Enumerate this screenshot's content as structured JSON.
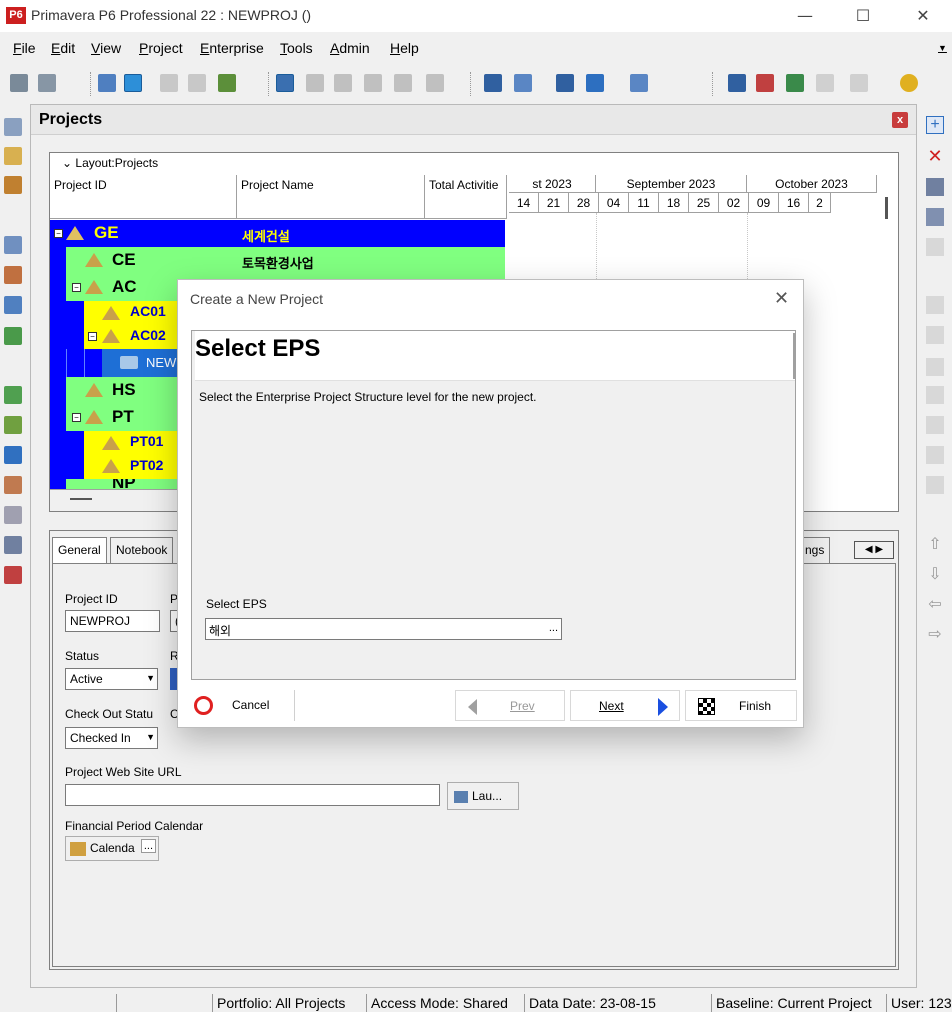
{
  "window": {
    "title": "Primavera P6 Professional 22 : NEWPROJ ()",
    "logo": "P6"
  },
  "window_controls": {
    "minimize": "—",
    "maximize": "☐",
    "close": "✕"
  },
  "menu": [
    "File",
    "Edit",
    "View",
    "Project",
    "Enterprise",
    "Tools",
    "Admin",
    "Help"
  ],
  "projects_panel": {
    "title": "Projects",
    "close": "x"
  },
  "grid": {
    "layout": "Layout:Projects",
    "columns": [
      "Project ID",
      "Project Name",
      "Total Activitie"
    ],
    "months": [
      "st 2023",
      "September 2023",
      "October 2023"
    ],
    "days": [
      "14",
      "21",
      "28",
      "04",
      "11",
      "18",
      "25",
      "02",
      "09",
      "16",
      "2"
    ],
    "rows": [
      {
        "id": "GE",
        "name": "세계건설"
      },
      {
        "id": "CE",
        "name": "토목환경사업"
      },
      {
        "id": "AC",
        "name": ""
      },
      {
        "id": "AC01",
        "name": ""
      },
      {
        "id": "AC02",
        "name": ""
      },
      {
        "id": "NEW",
        "name": ""
      },
      {
        "id": "HS",
        "name": ""
      },
      {
        "id": "PT",
        "name": ""
      },
      {
        "id": "PT01",
        "name": ""
      },
      {
        "id": "PT02",
        "name": ""
      },
      {
        "id": "NP",
        "name": ""
      }
    ]
  },
  "detail": {
    "tabs": [
      "General",
      "Notebook",
      "ngs"
    ],
    "project_id_label": "Project ID",
    "project_id_value": "NEWPROJ",
    "partial_label_a": "Pr",
    "partial_value_a": "(",
    "status_label": "Status",
    "status_value": "Active",
    "partial_label_b": "Ra",
    "checkout_label": "Check Out Statu",
    "partial_label_c": "Ch",
    "checkout_value": "Checked In",
    "web_url_label": "Project Web Site URL",
    "launch_button": "Lau...",
    "calendar_label": "Financial Period Calendar",
    "calendar_button": "Calenda",
    "ellipsis": "..."
  },
  "dialog": {
    "title": "Create a New Project",
    "heading": "Select EPS",
    "description": "Select the Enterprise Project Structure level for the new project.",
    "eps_label": "Select EPS",
    "eps_value": "해외",
    "browse": "...",
    "cancel": "Cancel",
    "prev": "Prev",
    "next": "Next",
    "finish": "Finish"
  },
  "status_bar": {
    "portfolio": "Portfolio: All Projects",
    "access_mode": "Access Mode: Shared",
    "data_date": "Data Date: 23-08-15",
    "baseline": "Baseline: Current Project",
    "user": "User: 123"
  },
  "colors": {
    "ge_row": "#0000ff",
    "ce_row": "#80ff80",
    "ac_row": "#ffff00",
    "new_row": "#1e6fd6",
    "ge_text": "#ffff00"
  }
}
